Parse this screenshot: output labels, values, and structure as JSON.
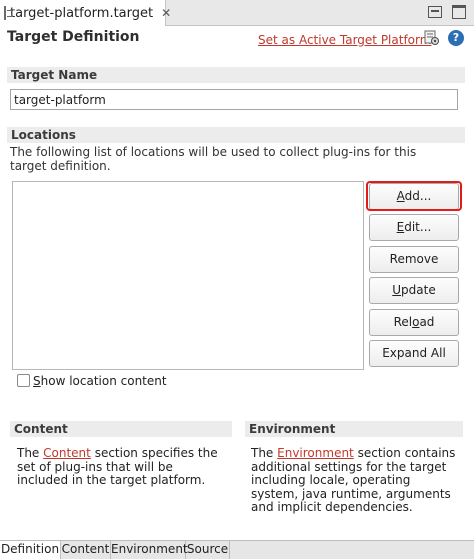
{
  "editor": {
    "tab_label": "target-platform.target",
    "close_glyph": "✕"
  },
  "header": {
    "title": "Target Definition",
    "set_active_link": "Set as Active Target Platform",
    "help_glyph": "?"
  },
  "target_name": {
    "section_title": "Target Name",
    "value": "target-platform"
  },
  "locations": {
    "section_title": "Locations",
    "description": "The following list of locations will be used to collect plug-ins for this target definition.",
    "buttons": [
      {
        "label": "Add...",
        "mnemonic": "A",
        "rest": "dd..."
      },
      {
        "label": "Edit...",
        "mnemonic": "E",
        "rest": "dit..."
      },
      {
        "label": "Remove",
        "mnemonic": "",
        "rest": "Remove"
      },
      {
        "label": "Update",
        "mnemonic": "U",
        "rest": "pdate"
      },
      {
        "label": "Reload",
        "pre": "Rel",
        "mnemonic": "o",
        "rest": "ad"
      },
      {
        "label": "Expand All",
        "mnemonic": "",
        "rest": "Expand All"
      }
    ],
    "highlighted_button": "Add...",
    "highlight_color": "#e21a1a",
    "show_content_checkbox": {
      "label": "Show location content",
      "mnemonic": "S",
      "rest": "how location content",
      "checked": false
    }
  },
  "content_section": {
    "title": "Content",
    "text_before": "The ",
    "link": "Content",
    "text_after": " section specifies the set of plug-ins that will be included in the target platform."
  },
  "environment_section": {
    "title": "Environment",
    "text_before": "The ",
    "link": "Environment",
    "text_after": " section contains additional settings for the target including locale, operating system, java runtime, arguments and implicit dependencies."
  },
  "bottom_tabs": [
    {
      "label": "Definition",
      "active": true
    },
    {
      "label": "Content",
      "active": false
    },
    {
      "label": "Environment",
      "active": false
    },
    {
      "label": "Source",
      "active": false
    }
  ],
  "colors": {
    "link": "#c0392b",
    "section_header_bg": "#ececec",
    "help_icon": "#2c6eb3"
  },
  "icons": [
    "file-icon",
    "close-icon",
    "minimize-icon",
    "maximize-icon",
    "gear-icon",
    "help-icon"
  ]
}
